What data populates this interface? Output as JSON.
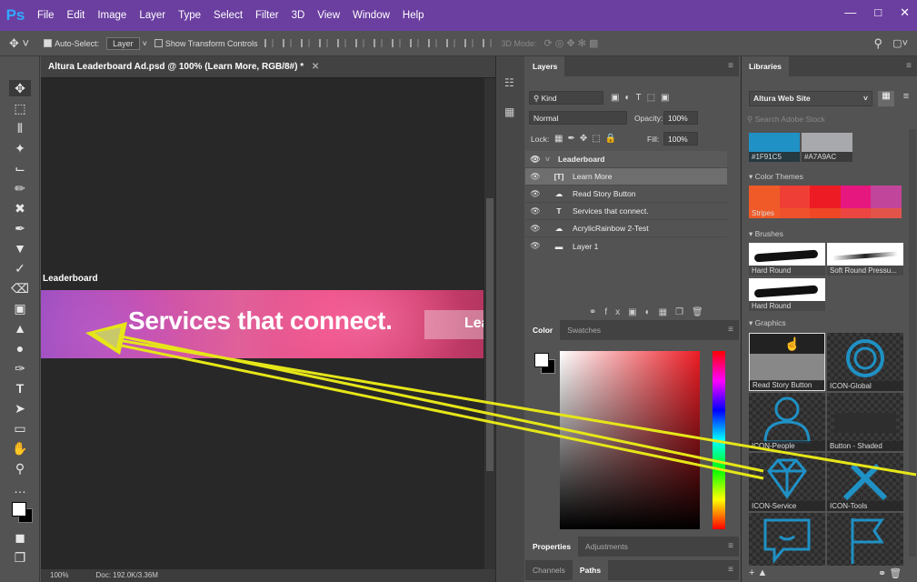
{
  "app": {
    "logo": "Ps",
    "menu": [
      "File",
      "Edit",
      "Image",
      "Layer",
      "Type",
      "Select",
      "Filter",
      "3D",
      "View",
      "Window",
      "Help"
    ]
  },
  "options": {
    "auto_select": "Auto-Select:",
    "auto_select_value": "Layer",
    "show_transform": "Show Transform Controls",
    "mode_3d": "3D Mode:"
  },
  "document": {
    "tab_title": "Altura Leaderboard Ad.psd @ 100% (Learn More, RGB/8#) *",
    "artboard_label": "Leaderboard",
    "banner_text": "Services that connect.",
    "banner_button": "Lear",
    "zoom": "100%",
    "doc_info": "Doc: 192.0K/3.36M"
  },
  "layers": {
    "tab": "Layers",
    "kind": "Kind",
    "blend": "Normal",
    "opacity_label": "Opacity:",
    "opacity": "100%",
    "lock_label": "Lock:",
    "fill_label": "Fill:",
    "fill": "100%",
    "items": [
      {
        "name": "Leaderboard"
      },
      {
        "name": "Learn More"
      },
      {
        "name": "Read Story Button"
      },
      {
        "name": "Services that connect."
      },
      {
        "name": "AcrylicRainbow 2-Test"
      },
      {
        "name": "Layer 1"
      }
    ]
  },
  "color": {
    "tabs": [
      "Color",
      "Swatches"
    ],
    "foreground": "#ffffff",
    "background": "#000000"
  },
  "props": {
    "tabs": [
      "Properties",
      "Adjustments"
    ]
  },
  "channels": {
    "tabs": [
      "Channels",
      "Paths"
    ]
  },
  "libraries": {
    "tab": "Libraries",
    "library": "Altura Web Site",
    "search_placeholder": "Search Adobe Stock",
    "swatches": [
      {
        "label": "#1F91C5",
        "color": "#1f91c5"
      },
      {
        "label": "#A7A9AC",
        "color": "#a7a9ac"
      }
    ],
    "color_themes_heading": "Color Themes",
    "theme_name": "Stripes",
    "theme_colors": [
      "#f05a28",
      "#ef3e36",
      "#ed1c24",
      "#e6177f",
      "#c1469b"
    ],
    "brushes_heading": "Brushes",
    "brushes": [
      {
        "label": "Hard Round"
      },
      {
        "label": "Soft Round Pressu..."
      },
      {
        "label": "Hard Round"
      }
    ],
    "graphics_heading": "Graphics",
    "graphics": [
      {
        "label": "Read Story Button"
      },
      {
        "label": "ICON-Global"
      },
      {
        "label": "ICON-People"
      },
      {
        "label": "Button - Shaded"
      },
      {
        "label": "ICON-Service"
      },
      {
        "label": "ICON-Tools"
      }
    ],
    "accent": "#1f91c5"
  }
}
